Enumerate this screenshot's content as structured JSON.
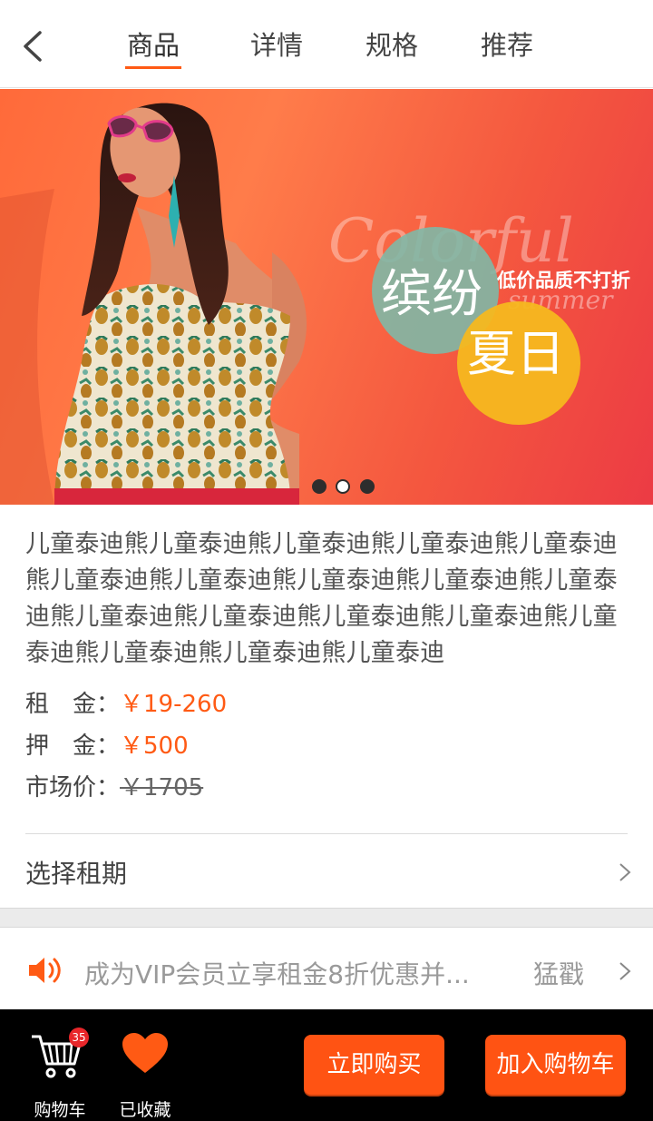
{
  "header": {
    "back_icon": "chevron-left-icon",
    "tabs": [
      {
        "label": "商品",
        "active": true
      },
      {
        "label": "详情",
        "active": false
      },
      {
        "label": "规格",
        "active": false
      },
      {
        "label": "推荐",
        "active": false
      }
    ]
  },
  "banner": {
    "script_text": "Colorful",
    "script_text_2": "summer",
    "circle_text_1": "缤纷",
    "circle_text_2": "夏日",
    "slogan": "低价品质不打折",
    "slides_total": 3,
    "active_slide": 1
  },
  "product": {
    "title": "儿童泰迪熊儿童泰迪熊儿童泰迪熊儿童泰迪熊儿童泰迪熊儿童泰迪熊儿童泰迪熊儿童泰迪熊儿童泰迪熊儿童泰迪熊儿童泰迪熊儿童泰迪熊儿童泰迪熊儿童泰迪熊儿童泰迪熊儿童泰迪熊儿童泰迪熊儿童泰迪",
    "rent_label": "租　金：",
    "rent_value": "￥19-260",
    "deposit_label": "押　金：",
    "deposit_value": "￥500",
    "market_label": "市场价：",
    "market_value": "￥1705"
  },
  "rental_period": {
    "label": "选择租期",
    "icon": "chevron-right-icon"
  },
  "notice": {
    "icon": "speaker-icon",
    "text": "成为VIP会员立享租金8折优惠并...",
    "more": "猛戳"
  },
  "bottom_bar": {
    "cart_label": "购物车",
    "cart_count": "35",
    "favorite_label": "已收藏",
    "buy_now": "立即购买",
    "add_to_cart": "加入购物车"
  },
  "colors": {
    "accent": "#ff5a14",
    "button": "#ff5313",
    "bottom_bar": "#000000",
    "badge": "#e8262a"
  }
}
